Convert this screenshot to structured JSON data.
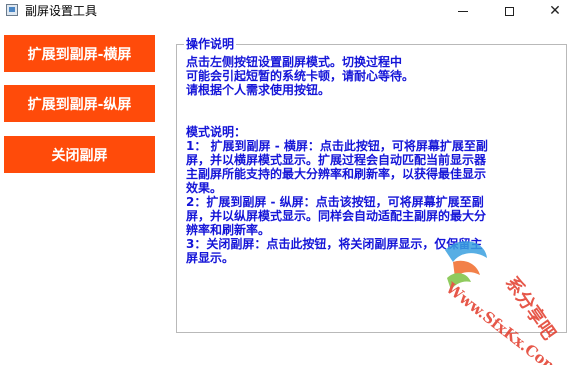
{
  "window": {
    "title": "副屏设置工具",
    "controls": {
      "minimize": "—",
      "maximize": "□",
      "close": "✕"
    }
  },
  "sidebar": {
    "buttons": [
      {
        "label": "扩展到副屏-横屏"
      },
      {
        "label": "扩展到副屏-纵屏"
      },
      {
        "label": "关闭副屏"
      }
    ],
    "button_color": "#ff4b0a"
  },
  "info": {
    "group_title": "操作说明",
    "intro_lines": [
      "点击左侧按钮设置副屏模式。切换过程中",
      "可能会引起短暂的系统卡顿，请耐心等待。",
      "请根据个人需求使用按钮。"
    ],
    "mode_title": "模式说明：",
    "mode_lines": [
      "1： 扩展到副屏 - 横屏：点击此按钮，可将屏幕扩展至副",
      "屏，并以横屏模式显示。扩展过程会自动匹配当前显示器",
      "主副屏所能支持的最大分辨率和刷新率，以获得最佳显示",
      "效果。",
      "2：扩展到副屏 - 纵屏：点击该按钮，可将屏幕扩展至副",
      "屏，并以纵屏模式显示。同样会自动适配主副屏的最大分",
      "辨率和刷新率。",
      "3：关闭副屏：点击此按钮，将关闭副屏显示，仅保留主",
      "屏显示。"
    ],
    "text_color": "#1515d8"
  },
  "watermark": {
    "text_cn": "系分享吧",
    "text_url": "Www.SfxKx.Com"
  }
}
